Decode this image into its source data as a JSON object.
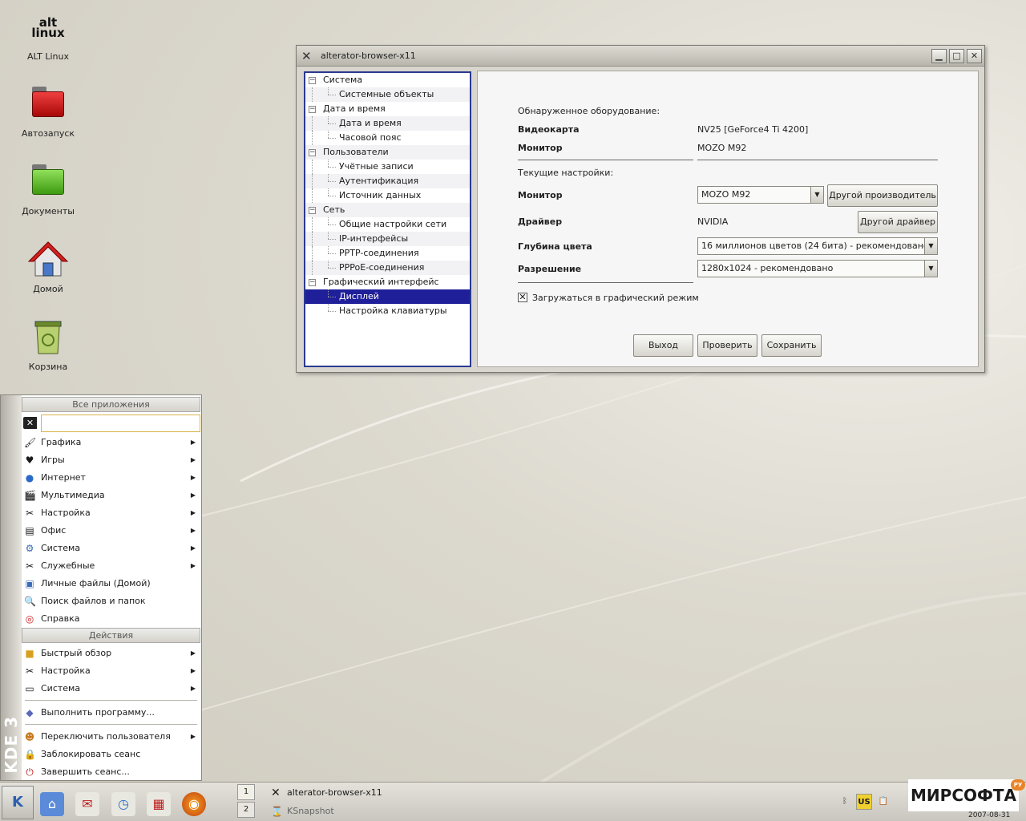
{
  "desktop": {
    "icons": [
      {
        "label": "ALT Linux",
        "logo_line1": "alt",
        "logo_line2": "linux"
      },
      {
        "label": "Автозапуск"
      },
      {
        "label": "Документы"
      },
      {
        "label": "Домой"
      },
      {
        "label": "Корзина"
      }
    ]
  },
  "window": {
    "title": "alterator-browser-x11",
    "tree": [
      {
        "label": "Система",
        "level": 0
      },
      {
        "label": "Системные объекты",
        "level": 1
      },
      {
        "label": "Дата и время",
        "level": 0
      },
      {
        "label": "Дата и время",
        "level": 1
      },
      {
        "label": "Часовой пояс",
        "level": 1
      },
      {
        "label": "Пользователи",
        "level": 0
      },
      {
        "label": "Учётные записи",
        "level": 1
      },
      {
        "label": "Аутентификация",
        "level": 1
      },
      {
        "label": "Источник данных",
        "level": 1
      },
      {
        "label": "Сеть",
        "level": 0
      },
      {
        "label": "Общие настройки сети",
        "level": 1
      },
      {
        "label": "IP-интерфейсы",
        "level": 1
      },
      {
        "label": "PPTP-соединения",
        "level": 1
      },
      {
        "label": "PPPoE-соединения",
        "level": 1
      },
      {
        "label": "Графический интерфейс",
        "level": 0
      },
      {
        "label": "Дисплей",
        "level": 1,
        "selected": true
      },
      {
        "label": "Настройка клавиатуры",
        "level": 1
      }
    ],
    "panel": {
      "detected_header": "Обнаруженное оборудование:",
      "videocard_label": "Видеокарта",
      "videocard_value": "NV25 [GeForce4 Ti 4200]",
      "monitor_label": "Монитор",
      "monitor_value": "MOZO M92",
      "current_header": "Текущие настройки:",
      "monitor2_label": "Монитор",
      "monitor2_select": "MOZO M92",
      "other_vendor_button": "Другой производитель",
      "driver_label": "Драйвер",
      "driver_value": "NVIDIA",
      "other_driver_button": "Другой драйвер",
      "depth_label": "Глубина цвета",
      "depth_select": "16 миллионов цветов (24 бита) - рекомендовано",
      "resolution_label": "Разрешение",
      "resolution_select": "1280x1024 - рекомендовано",
      "boot_graphic_checkbox": "Загружаться в графический режим",
      "boot_graphic_checked": true,
      "exit_button": "Выход",
      "check_button": "Проверить",
      "save_button": "Сохранить"
    }
  },
  "start_menu": {
    "side_label": "KDE 3",
    "all_apps_header": "Все приложения",
    "search_value": "",
    "apps": [
      {
        "label": "Графика",
        "submenu": true,
        "icon": "paintbrush-icon"
      },
      {
        "label": "Игры",
        "submenu": true,
        "icon": "cards-icon"
      },
      {
        "label": "Интернет",
        "submenu": true,
        "icon": "globe-icon"
      },
      {
        "label": "Мультимедиа",
        "submenu": true,
        "icon": "clapperboard-icon"
      },
      {
        "label": "Настройка",
        "submenu": true,
        "icon": "tools-icon"
      },
      {
        "label": "Офис",
        "submenu": true,
        "icon": "document-icon"
      },
      {
        "label": "Система",
        "submenu": true,
        "icon": "gear-icon"
      },
      {
        "label": "Служебные",
        "submenu": true,
        "icon": "utility-icon"
      },
      {
        "label": "Личные файлы (Домой)",
        "submenu": false,
        "icon": "home-folder-icon"
      },
      {
        "label": "Поиск файлов и папок",
        "submenu": false,
        "icon": "search-icon"
      },
      {
        "label": "Справка",
        "submenu": false,
        "icon": "lifebuoy-icon"
      }
    ],
    "actions_header": "Действия",
    "actions": [
      {
        "label": "Быстрый обзор",
        "submenu": true,
        "icon": "folder-icon"
      },
      {
        "label": "Настройка",
        "submenu": true,
        "icon": "tools-icon"
      },
      {
        "label": "Система",
        "submenu": true,
        "icon": "monitor-icon"
      }
    ],
    "run_command": "Выполнить программу...",
    "session": [
      {
        "label": "Переключить пользователя",
        "submenu": true,
        "icon": "users-icon"
      },
      {
        "label": "Заблокировать сеанс",
        "submenu": false,
        "icon": "lock-icon"
      },
      {
        "label": "Завершить сеанс...",
        "submenu": false,
        "icon": "logout-icon"
      }
    ]
  },
  "taskbar": {
    "pager": [
      "1",
      "2"
    ],
    "tasks": [
      "alterator-browser-x11",
      "KSnapshot"
    ],
    "keyboard_layout": "US",
    "clock_date": "2007-08-31",
    "watermark": "МИРСОФТА",
    "watermark_badge": "РУ"
  },
  "colors": {
    "selection": "#1f1f9a",
    "tree_border": "#2a3a90",
    "search_border": "#d8b44a"
  }
}
